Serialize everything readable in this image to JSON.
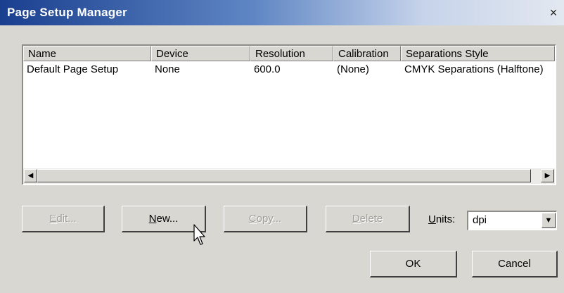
{
  "window": {
    "title": "Page Setup Manager",
    "close_glyph": "×"
  },
  "list": {
    "columns": [
      "Name",
      "Device",
      "Resolution",
      "Calibration",
      "Separations Style"
    ],
    "rows": [
      [
        "Default Page Setup",
        "None",
        "600.0",
        "(None)",
        "CMYK Separations (Halftone)"
      ]
    ]
  },
  "scrollbar": {
    "left_arrow": "◀",
    "right_arrow": "▶"
  },
  "buttons": {
    "edit": {
      "mnemonic": "E",
      "rest": "dit..."
    },
    "new": {
      "mnemonic": "N",
      "rest": "ew..."
    },
    "copy": {
      "mnemonic": "C",
      "rest": "opy..."
    },
    "delete": {
      "mnemonic": "D",
      "rest": "elete"
    },
    "ok": "OK",
    "cancel": "Cancel"
  },
  "units": {
    "label_mnemonic": "U",
    "label_rest": "nits:",
    "value": "dpi",
    "arrow": "▼"
  },
  "icons": {
    "cursor": "arrow-pointer-icon"
  }
}
